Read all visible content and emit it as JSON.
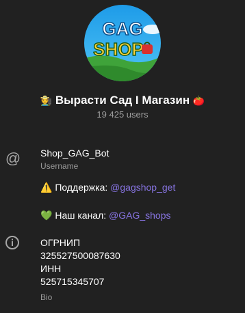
{
  "header": {
    "avatar_logo_line1": "GAG",
    "avatar_logo_line2": "SHOP",
    "title_emoji_left": "🧑‍🌾",
    "title": "Вырасти Сад I Магазин",
    "title_emoji_right": "🍅",
    "member_count": "19 425 users"
  },
  "username_block": {
    "value": "Shop_GAG_Bot",
    "caption": "Username",
    "support_emoji": "⚠️",
    "support_label": "Поддержка:",
    "support_link": "@gagshop_get",
    "channel_emoji": "💚",
    "channel_label": "Наш канал:",
    "channel_link": "@GAG_shops"
  },
  "bio_block": {
    "line1": "ОГРНИП",
    "line2": "325527500087630",
    "line3": "ИНН",
    "line4": "525715345707",
    "caption": "Bio"
  }
}
